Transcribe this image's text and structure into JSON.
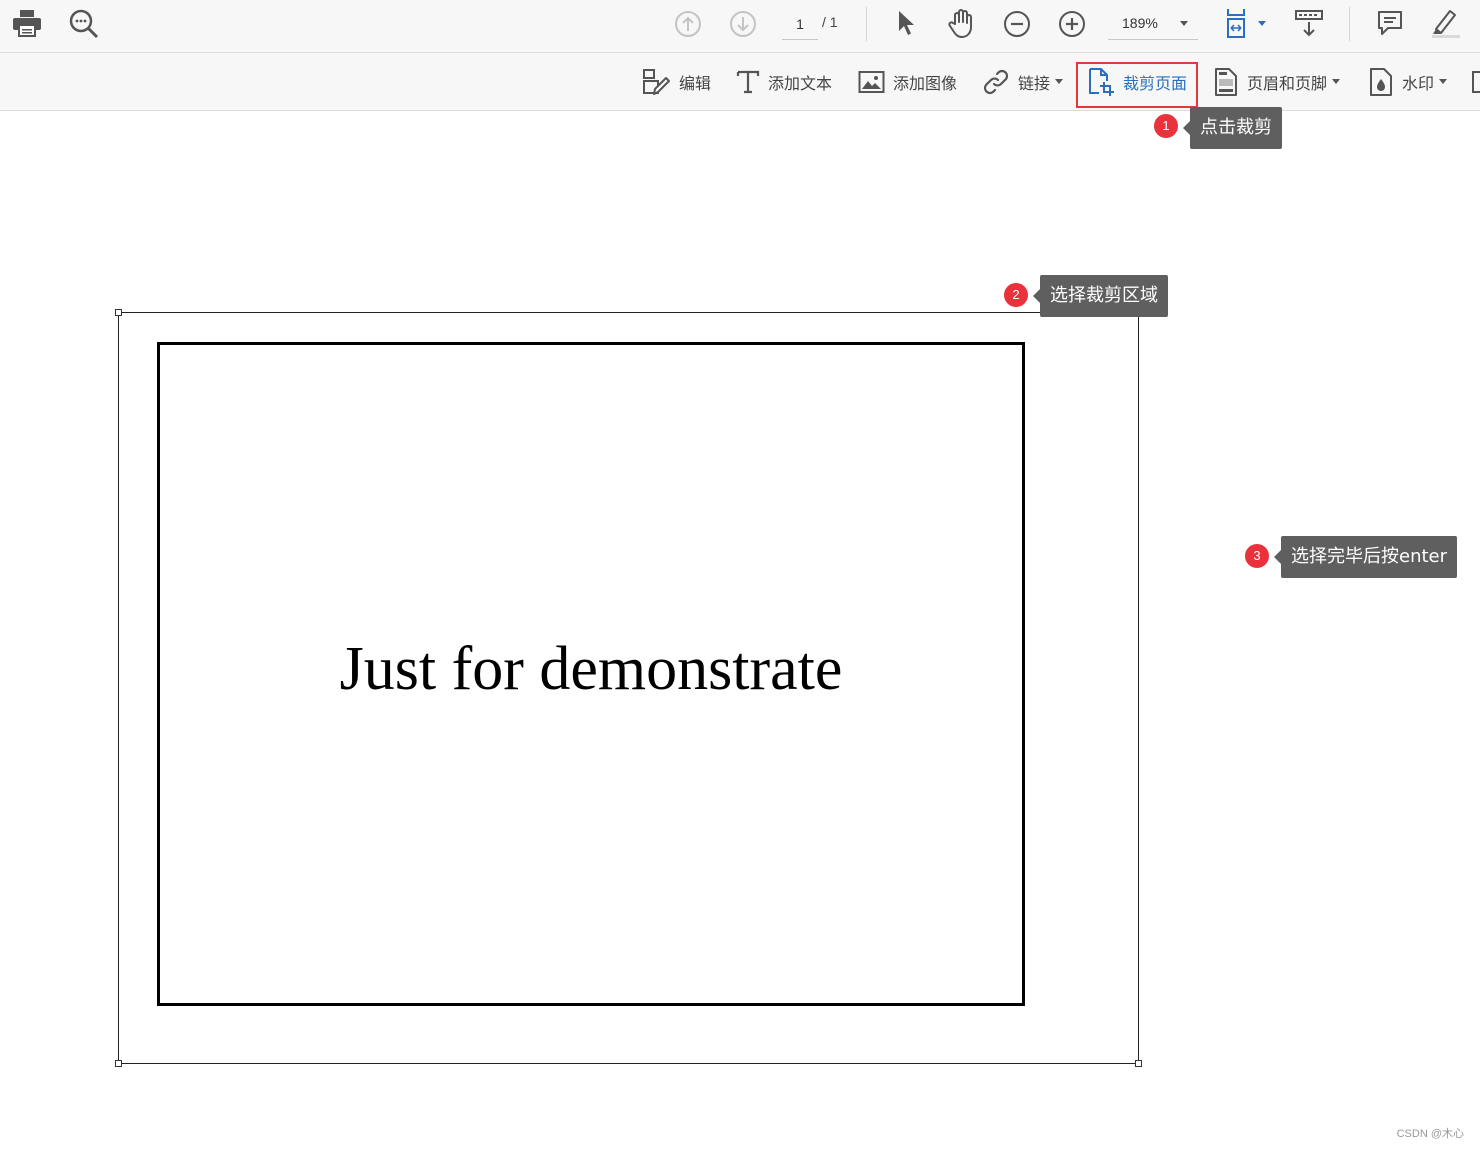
{
  "toolbar_top": {
    "page_current": "1",
    "page_total": "/ 1",
    "zoom": "189%"
  },
  "toolbar_edit": {
    "edit": "编辑",
    "add_text": "添加文本",
    "add_image": "添加图像",
    "link": "链接",
    "crop_page": "裁剪页面",
    "header_footer": "页眉和页脚",
    "watermark": "水印"
  },
  "annotations": [
    {
      "num": "1",
      "text": "点击裁剪"
    },
    {
      "num": "2",
      "text": "选择裁剪区域"
    },
    {
      "num": "3",
      "text": "选择完毕后按enter"
    }
  ],
  "document": {
    "text": "Just for demonstrate"
  },
  "watermark_text": "CSDN @木心",
  "colors": {
    "accent": "#2a6ebf",
    "highlight": "#e03b3b",
    "step_badge": "#e9323b",
    "callout_bg": "#5f5f5f"
  }
}
